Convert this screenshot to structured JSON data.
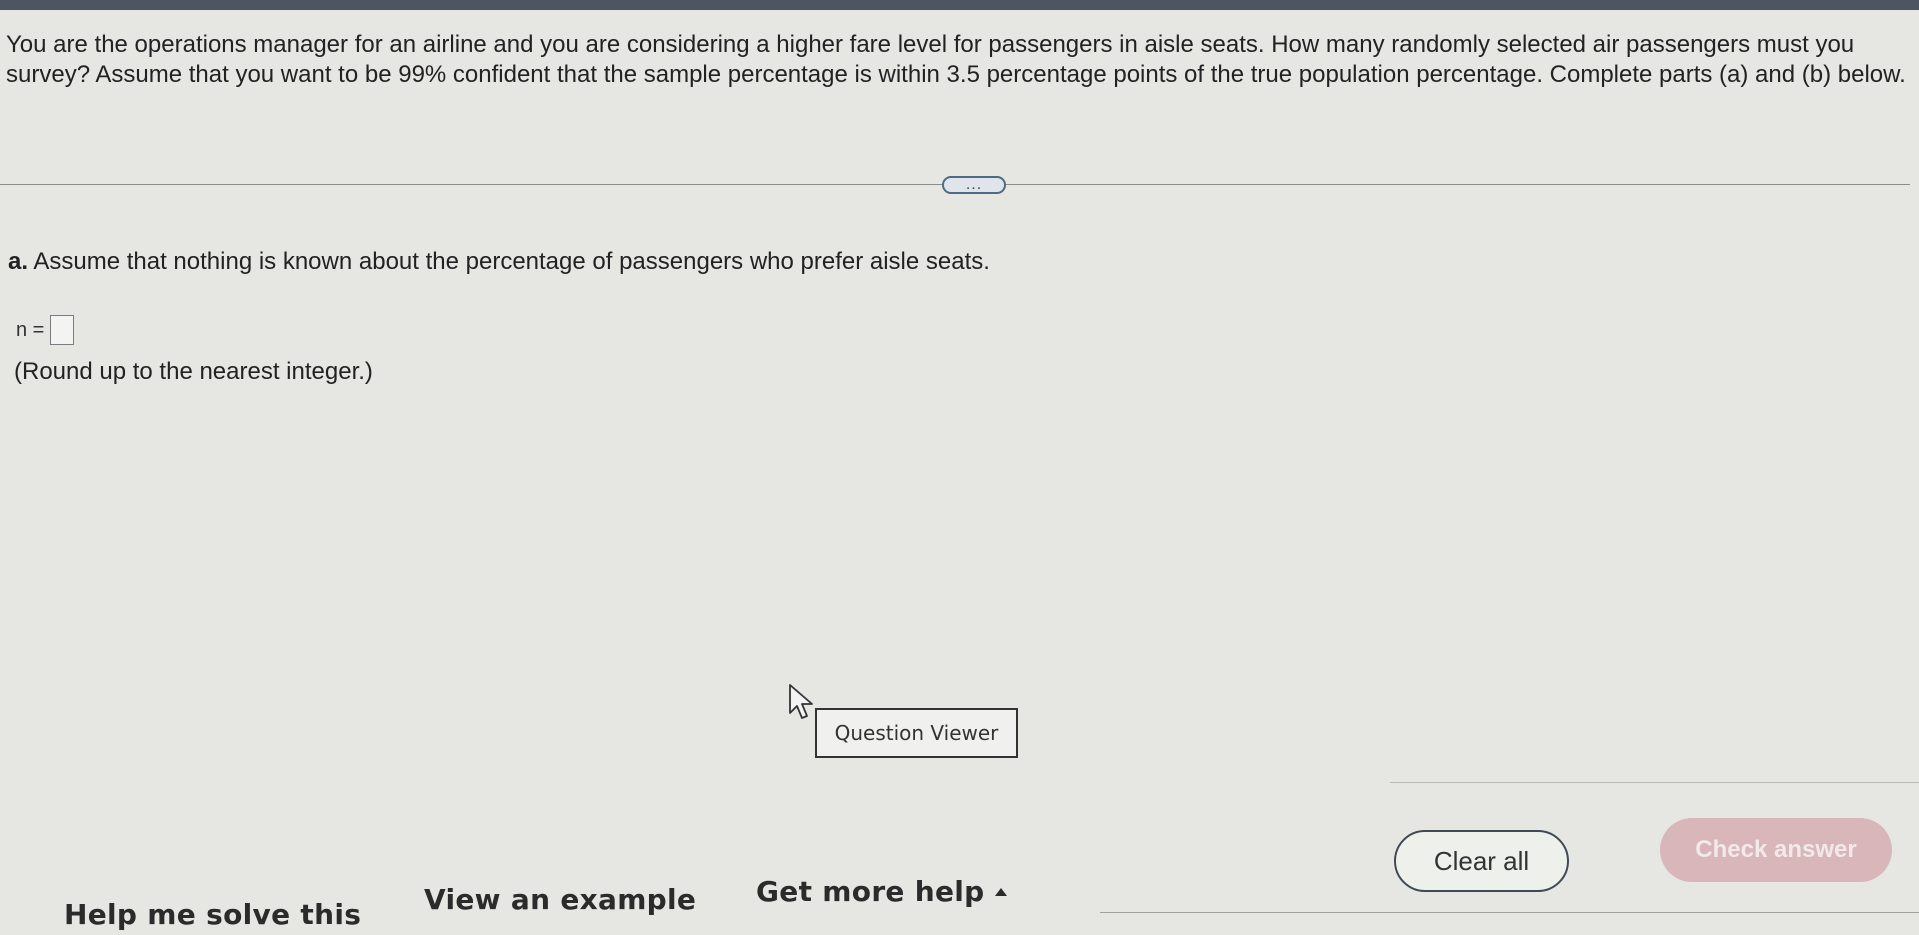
{
  "question": {
    "text": "You are the operations manager for an airline and you are considering a higher fare level for passengers in aisle seats. How many randomly selected air passengers must you survey? Assume that you want to be 99% confident that the sample percentage is within 3.5 percentage points of the true population percentage. Complete parts (a) and (b) below."
  },
  "more_button": {
    "label": "..."
  },
  "part_a": {
    "letter": "a.",
    "text": "Assume that nothing is known about the percentage of passengers who prefer aisle seats.",
    "answer_label": "n =",
    "answer_value": "",
    "hint": "(Round up to the nearest integer.)"
  },
  "question_viewer": {
    "label": "Question Viewer"
  },
  "actions": {
    "clear_all": "Clear all",
    "check_answer": "Check answer"
  },
  "help": {
    "help_me_solve": "Help me solve this",
    "view_example": "View an example",
    "get_more_help": "Get more help"
  },
  "icons": {
    "cursor": "mouse-pointer-icon",
    "caret": "caret-up-icon"
  },
  "colors": {
    "check_answer_disabled": "#d8b6b9",
    "more_button_border": "#4f6a82"
  }
}
